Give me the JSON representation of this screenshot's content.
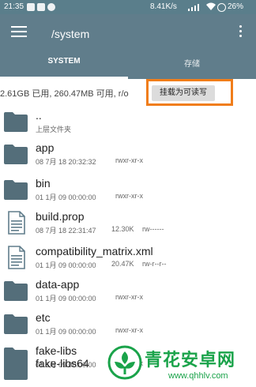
{
  "status_bar": {
    "time": "21:35",
    "net_speed": "8.41K/s",
    "battery": "26%"
  },
  "app_bar": {
    "path": "/system",
    "tabs": [
      {
        "label": "SYSTEM",
        "active": true
      },
      {
        "label": "存储",
        "active": false
      }
    ]
  },
  "info_bar": {
    "storage_text": "2.61GB 已用, 260.47MB 可用, r/o",
    "mount_button": "挂载为可读写"
  },
  "files": [
    {
      "name": "..",
      "sub": "上层文件夹",
      "type": "folder"
    },
    {
      "name": "app",
      "date": "08 7月 18 20:32:32",
      "perm": "rwxr-xr-x",
      "type": "folder"
    },
    {
      "name": "bin",
      "date": "01 1月 09 00:00:00",
      "perm": "rwxr-xr-x",
      "type": "folder"
    },
    {
      "name": "build.prop",
      "date": "08 7月 18 22:31:47",
      "size": "12.30K",
      "perm": "rw------",
      "type": "file"
    },
    {
      "name": "compatibility_matrix.xml",
      "date": "01 1月 09 00:00:00",
      "size": "20.47K",
      "perm": "rw-r--r--",
      "type": "file"
    },
    {
      "name": "data-app",
      "date": "01 1月 09 00:00:00",
      "perm": "rwxr-xr-x",
      "type": "folder"
    },
    {
      "name": "etc",
      "date": "01 1月 09 00:00:00",
      "perm": "rwxr-xr-x",
      "type": "folder"
    },
    {
      "name": "fake-libs",
      "date": "01 1月 09 00:00:00",
      "perm": "rwxr-xr-x",
      "type": "folder"
    },
    {
      "name": "fake-libs64",
      "type": "folder"
    }
  ],
  "watermark": {
    "title": "青花安卓网",
    "url": "www.qhhlv.com"
  },
  "colors": {
    "app_bar": "#607d8b",
    "status_bar": "#5a7e8b",
    "folder": "#546e7a",
    "highlight": "#f07d1a",
    "watermark": "#1aa34a"
  }
}
